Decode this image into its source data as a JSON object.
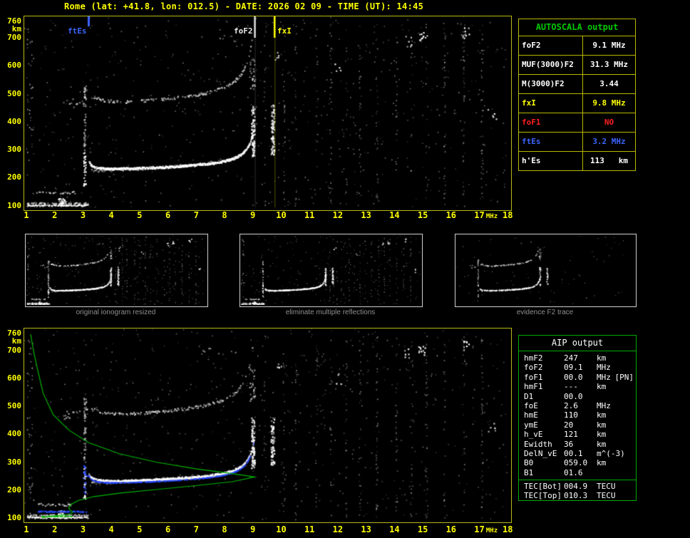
{
  "title": "Rome (lat: +41.8, lon: 012.5) - DATE: 2026 02 09 - TIME (UT): 14:45",
  "autoscala_table": {
    "header": "AUTOSCALA output",
    "rows": [
      {
        "param": "foF2",
        "value": "9.1 MHz",
        "color": "#ffffff"
      },
      {
        "param": "MUF(3000)F2",
        "value": "31.3 MHz",
        "color": "#ffffff"
      },
      {
        "param": "M(3000)F2",
        "value": "3.44",
        "color": "#ffffff"
      },
      {
        "param": "fxI",
        "value": "9.8 MHz",
        "color": "#ffff00"
      },
      {
        "param": "foF1",
        "value": "NO",
        "color": "#ff2020"
      },
      {
        "param": "ftEs",
        "value": "3.2 MHz",
        "color": "#3c64ff"
      },
      {
        "param": "h'Es",
        "value": "113   km",
        "color": "#ffffff"
      }
    ]
  },
  "aip_table": {
    "header": "AIP output",
    "rows": [
      {
        "param": "hmF2",
        "value": "247",
        "unit": "km",
        "note": ""
      },
      {
        "param": "foF2",
        "value": "09.1",
        "unit": "MHz",
        "note": ""
      },
      {
        "param": "foF1",
        "value": "00.0",
        "unit": "MHz",
        "note": "[PN]"
      },
      {
        "param": "hmF1",
        "value": "---",
        "unit": "km",
        "note": ""
      },
      {
        "param": "D1",
        "value": "00.0",
        "unit": "",
        "note": ""
      },
      {
        "param": "foE",
        "value": "2.6",
        "unit": "MHz",
        "note": ""
      },
      {
        "param": "hmE",
        "value": "110",
        "unit": "km",
        "note": ""
      },
      {
        "param": "ymE",
        "value": "20",
        "unit": "km",
        "note": ""
      },
      {
        "param": "h_vE",
        "value": "121",
        "unit": "km",
        "note": ""
      },
      {
        "param": "Ewidth",
        "value": "36",
        "unit": "km",
        "note": ""
      },
      {
        "param": "DelN_vE",
        "value": "00.1",
        "unit": "m^(-3)",
        "note": ""
      },
      {
        "param": "B0",
        "value": "059.0",
        "unit": "km",
        "note": ""
      },
      {
        "param": "B1",
        "value": "01.6",
        "unit": "",
        "note": ""
      }
    ],
    "tec_rows": [
      {
        "param": "TEC[Bot]",
        "value": "004.9",
        "unit": "TECU"
      },
      {
        "param": "TEC[Top]",
        "value": "010.3",
        "unit": "TECU"
      }
    ]
  },
  "thumbnails": [
    {
      "caption": "original ionogram resized"
    },
    {
      "caption": "eliminate multiple reflections"
    },
    {
      "caption": "evidence F2 trace"
    }
  ],
  "chart_data": [
    {
      "type": "scatter",
      "title": "ionogram with autoscaled characteristics (top panel)",
      "xlabel": "MHz",
      "ylabel": "km",
      "xlim": [
        1,
        18
      ],
      "ylim": [
        100,
        760
      ],
      "grid": false,
      "x_ticks": [
        1,
        2,
        3,
        4,
        5,
        6,
        7,
        8,
        9,
        10,
        11,
        12,
        13,
        14,
        15,
        16,
        17,
        18
      ],
      "y_ticks": [
        760,
        700,
        600,
        500,
        400,
        300,
        200,
        100
      ],
      "annotations": [
        {
          "label": "ftEs",
          "f_MHz": 3.2,
          "color": "#3c64ff",
          "label_x": 95
        },
        {
          "label": "foF2",
          "f_MHz": 9.1,
          "color": "#e8e8e8",
          "label_x": 328
        },
        {
          "label": "fxI",
          "f_MHz": 9.8,
          "color": "#ffff00",
          "label_x": 389
        }
      ],
      "scaled_values": {
        "foF2_MHz": 9.1,
        "MUF3000F2_MHz": 31.3,
        "M3000F2": 3.44,
        "fxI_MHz": 9.8,
        "foF1": "NO",
        "ftEs_MHz": 3.2,
        "hEs_km": 113
      },
      "trace_model": {
        "f2_base_height_km": 222,
        "f2_slope_km_per_MHz": 3.5,
        "f2_asymptote_MHz": 9.3,
        "cusp_MHz": 3.05,
        "es_height_km": 104,
        "second_hop": true
      }
    },
    {
      "type": "scatter+line",
      "title": "ionogram with restored trace and electron density profile (bottom panel)",
      "xlabel": "MHz",
      "ylabel": "km",
      "xlim": [
        1,
        18
      ],
      "ylim": [
        100,
        760
      ],
      "x_ticks": [
        1,
        2,
        3,
        4,
        5,
        6,
        7,
        8,
        9,
        10,
        11,
        12,
        13,
        14,
        15,
        16,
        17,
        18
      ],
      "y_ticks": [
        760,
        700,
        600,
        500,
        400,
        300,
        200,
        100
      ],
      "restored_trace_color": "#2747ff",
      "profile_line": {
        "color": "#00b400",
        "points_f_h": [
          [
            1.15,
            757
          ],
          [
            1.25,
            700
          ],
          [
            1.4,
            630
          ],
          [
            1.6,
            545
          ],
          [
            1.95,
            470
          ],
          [
            2.5,
            415
          ],
          [
            3.2,
            370
          ],
          [
            4.3,
            330
          ],
          [
            5.6,
            300
          ],
          [
            7.0,
            276
          ],
          [
            8.2,
            260
          ],
          [
            8.9,
            250
          ],
          [
            9.1,
            247
          ],
          [
            8.3,
            230
          ],
          [
            7.0,
            216
          ],
          [
            5.6,
            202
          ],
          [
            4.4,
            190
          ],
          [
            3.4,
            177
          ],
          [
            2.85,
            163
          ],
          [
            2.6,
            150
          ],
          [
            2.5,
            138
          ],
          [
            2.55,
            128
          ],
          [
            2.65,
            121
          ],
          [
            2.55,
            114
          ],
          [
            2.2,
            110
          ],
          [
            1.8,
            106
          ],
          [
            1.55,
            101
          ]
        ]
      }
    }
  ]
}
